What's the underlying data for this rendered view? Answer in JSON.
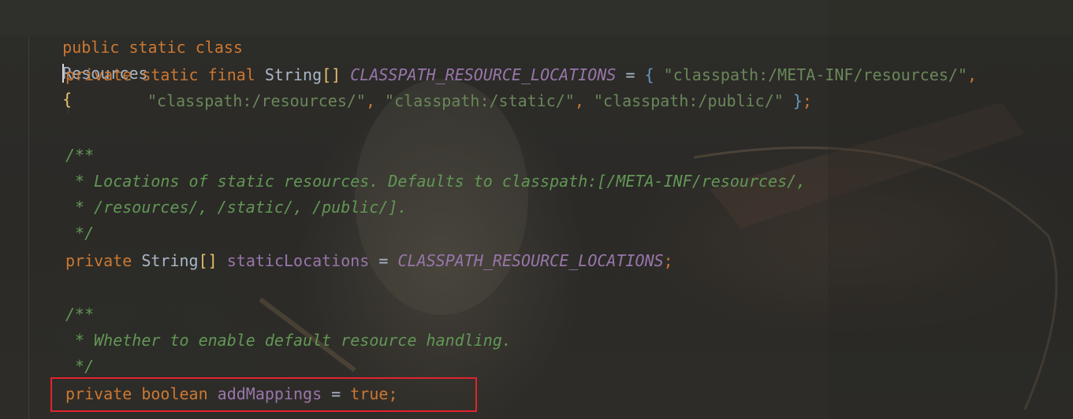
{
  "code": {
    "line1": {
      "kw": "public static class",
      "name": "Resources",
      "brace": "{"
    },
    "line2": {
      "kw": "private static final",
      "type": "String",
      "brackets": "[]",
      "name": "CLASSPATH_RESOURCE_LOCATIONS",
      "op": "=",
      "brace": "{",
      "s1": "\"classpath:/META-INF/resources/\"",
      "comma": ","
    },
    "line3": {
      "s2": "\"classpath:/resources/\"",
      "s3": "\"classpath:/static/\"",
      "s4": "\"classpath:/public/\"",
      "brace": "}",
      "semi": ";"
    },
    "comment1": {
      "open": "/**",
      "l1": " * Locations of static resources. Defaults to classpath:[/META-INF/resources/,",
      "l2": " * /resources/, /static/, /public/].",
      "close": " */"
    },
    "line4": {
      "kw": "private",
      "type": "String",
      "brackets": "[]",
      "name": "staticLocations",
      "op": "=",
      "value": "CLASSPATH_RESOURCE_LOCATIONS",
      "semi": ";"
    },
    "comment2": {
      "open": "/**",
      "l1": " * Whether to enable default resource handling.",
      "close": " */"
    },
    "line5": {
      "kw": "private boolean",
      "name": "addMappings",
      "op": "=",
      "value": "true",
      "semi": ";"
    }
  },
  "colors": {
    "keyword": "#cc7832",
    "string": "#6a8759",
    "comment": "#629755",
    "field": "#9876aa",
    "highlight_box": "#e0242d"
  }
}
